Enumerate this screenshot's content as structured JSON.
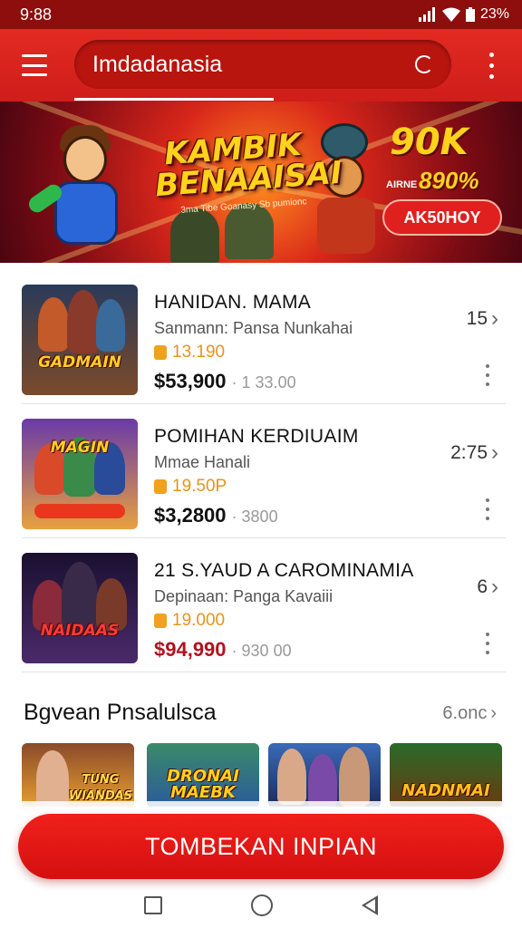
{
  "status_bar": {
    "time": "9:88",
    "battery": "23%",
    "signal_icon": "signal-icon",
    "wifi_icon": "wifi-icon",
    "battery_icon": "battery-icon"
  },
  "app_bar": {
    "search_value": "Imdadanasia",
    "menu_icon": "hamburger-icon",
    "refresh_icon": "refresh-icon",
    "more_icon": "more-vert-icon",
    "color": "#d9231d"
  },
  "banner": {
    "title": "KAMBIK BENAAISAI",
    "subtitle": "3ma Tibe Goanasy  Sb pumionc",
    "amount": "90K",
    "small_label": "AIRNE",
    "bonus": "890%",
    "cta": "AK50HOY"
  },
  "items": [
    {
      "title": "HANIDAN. MAMA",
      "subtitle": "Sanmann: Pansa Nunkahai",
      "points": "13.190",
      "price": "$53,900",
      "old_price": "1 33.00",
      "count": "15",
      "thumb_label": "GADMAIN",
      "price_color": "#111111"
    },
    {
      "title": "POMIHAN KERDIUAIM",
      "subtitle": "Mmae Hanali",
      "points": "19.50P",
      "price": "$3,2800",
      "old_price": "3800",
      "count": "2:75",
      "thumb_label": "MAGIN",
      "price_color": "#111111"
    },
    {
      "title": "21 S.YAUD A CAROMINAMIA",
      "subtitle": "Depinaan: Panga Kavaiii",
      "points": "19.000",
      "price": "$94,990",
      "old_price": "930 00",
      "count": "6",
      "thumb_label": "NAIDAAS",
      "price_color": "#b5101f"
    }
  ],
  "section": {
    "title": "Bgvean Pnsalulsca",
    "link": "6.onc"
  },
  "cards": [
    {
      "label": "TUNG WIANDAS"
    },
    {
      "label": "DRONAI MAEBK"
    },
    {
      "label": ""
    },
    {
      "label": "NADNMAI"
    }
  ],
  "cta_button": "TOMBEKAN INPIAN",
  "navigation": {
    "recents_icon": "square-icon",
    "home_icon": "circle-icon",
    "back_icon": "triangle-back-icon"
  }
}
